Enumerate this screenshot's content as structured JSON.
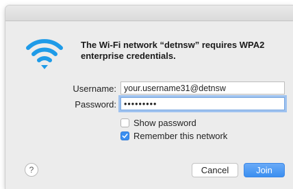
{
  "dialog": {
    "message": "The Wi-Fi network “detnsw” requires WPA2 enterprise credentials.",
    "icon": "wifi-icon"
  },
  "form": {
    "username_label": "Username:",
    "username_value": "your.username31@detnsw",
    "password_label": "Password:",
    "password_value": "•••••••••",
    "show_password_label": "Show password",
    "show_password_checked": false,
    "remember_label": "Remember this network",
    "remember_checked": true
  },
  "buttons": {
    "help_label": "?",
    "cancel_label": "Cancel",
    "join_label": "Join"
  },
  "colors": {
    "accent": "#3b8ff0",
    "wifi_icon": "#1e9be8",
    "focus_ring": "#9ec2ef"
  }
}
